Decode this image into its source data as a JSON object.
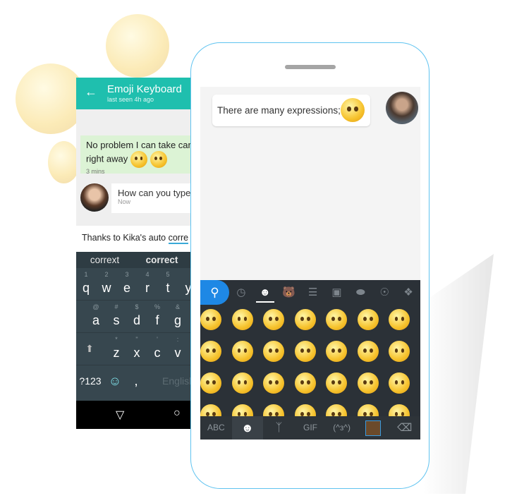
{
  "back_phone": {
    "header": {
      "title": "Emoji Keyboard",
      "subtitle": "last seen 4h ago"
    },
    "messages": [
      {
        "text_line1": "No problem I can take car",
        "text_line2": "right away",
        "time": "3 mins"
      },
      {
        "text": "How can  you type",
        "time": "Now"
      }
    ],
    "input": {
      "prefix": "Thanks to Kika's auto ",
      "underlined": "corre"
    },
    "suggestions": [
      "corrext",
      "correct"
    ],
    "keys_row1": [
      {
        "k": "q",
        "h": "1"
      },
      {
        "k": "w",
        "h": "2"
      },
      {
        "k": "e",
        "h": "3"
      },
      {
        "k": "r",
        "h": "4"
      },
      {
        "k": "t",
        "h": "5"
      },
      {
        "k": "y",
        "h": ""
      }
    ],
    "keys_row2": [
      {
        "k": "a",
        "h": "@"
      },
      {
        "k": "s",
        "h": "#"
      },
      {
        "k": "d",
        "h": "$"
      },
      {
        "k": "f",
        "h": "%"
      },
      {
        "k": "g",
        "h": "&"
      }
    ],
    "keys_row3": [
      {
        "k": "z",
        "h": "*"
      },
      {
        "k": "x",
        "h": "\""
      },
      {
        "k": "c",
        "h": "'"
      },
      {
        "k": "v",
        "h": ":"
      }
    ],
    "symbols_key": "?123",
    "comma_key": ",",
    "space_label": "English"
  },
  "front_phone": {
    "message": "There are many expressions;",
    "categories": [
      "search",
      "recent",
      "smileys",
      "animals",
      "food",
      "travel",
      "sports",
      "objects",
      "symbols"
    ],
    "bottom_bar": {
      "abc": "ABC",
      "gif": "GIF",
      "kaomoji": "(^з^)"
    }
  },
  "colors": {
    "header": "#1fbfae",
    "accent": "#1e88e5",
    "keyboard_dark": "#2b3137",
    "phone_outline": "#5fc3f0"
  }
}
